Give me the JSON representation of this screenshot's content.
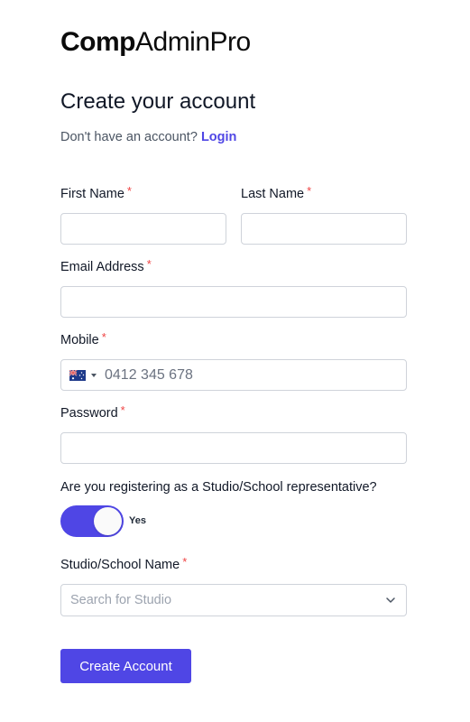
{
  "brand": {
    "bold": "Comp",
    "regular": "AdminPro"
  },
  "heading": "Create your account",
  "subline": {
    "text": "Don't have an account?",
    "link": "Login"
  },
  "fields": {
    "first_name": {
      "label": "First Name",
      "value": ""
    },
    "last_name": {
      "label": "Last Name",
      "value": ""
    },
    "email": {
      "label": "Email Address",
      "value": ""
    },
    "mobile": {
      "label": "Mobile",
      "placeholder": "0412 345 678",
      "country_icon": "australia-flag-icon"
    },
    "password": {
      "label": "Password",
      "value": ""
    }
  },
  "required_marker": "*",
  "representative": {
    "question": "Are you registering as a Studio/School representative?",
    "toggle_on": true,
    "toggle_label": "Yes"
  },
  "studio": {
    "label": "Studio/School Name",
    "placeholder": "Search for Studio"
  },
  "submit_label": "Create Account",
  "colors": {
    "accent": "#4f46e5",
    "required": "#ef4444",
    "border": "#cfd3da"
  }
}
